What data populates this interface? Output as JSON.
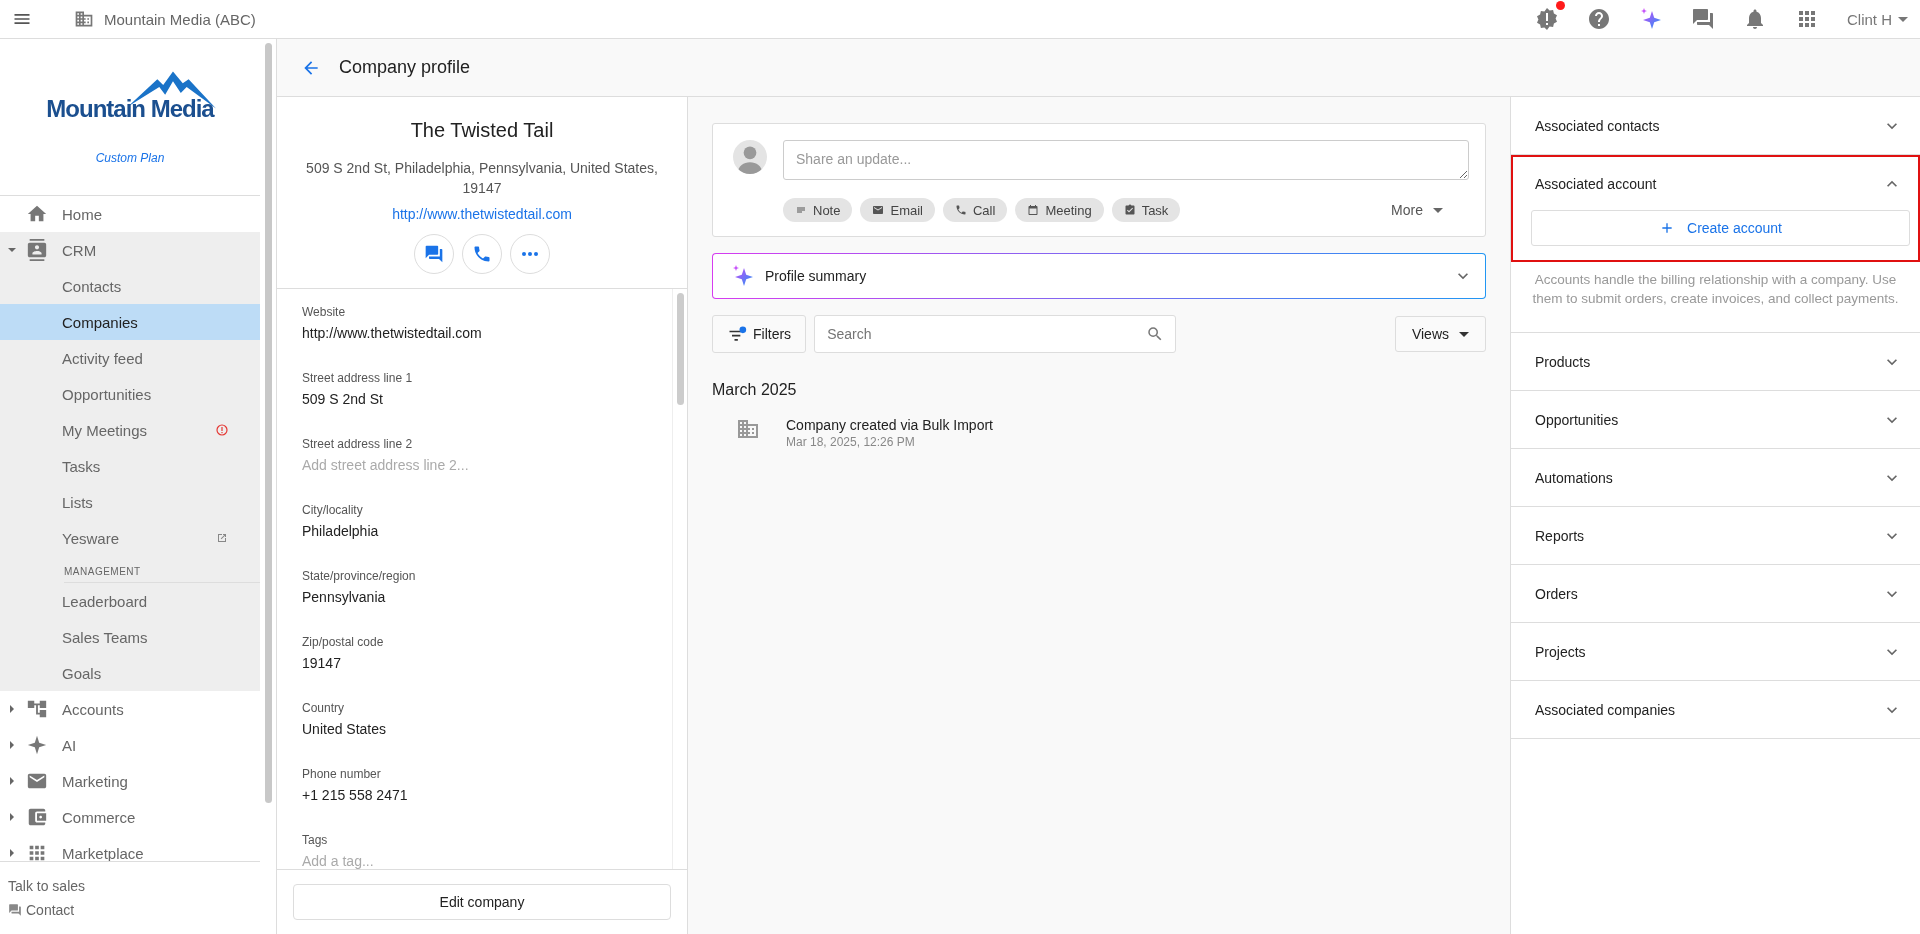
{
  "top_bar": {
    "org": "Mountain Media (ABC)",
    "alert_dot": true,
    "user": "Clint H"
  },
  "sidebar": {
    "logo_text": "Mountain Media",
    "plan": "Custom Plan",
    "items": [
      {
        "label": "Home"
      },
      {
        "label": "CRM",
        "expanded": true,
        "children": [
          {
            "kind": "link",
            "label": "Contacts",
            "selected": false,
            "alert": false,
            "external": false
          },
          {
            "kind": "link",
            "label": "Companies",
            "selected": true,
            "alert": false,
            "external": false
          },
          {
            "kind": "link",
            "label": "Activity feed",
            "selected": false,
            "alert": false,
            "external": false
          },
          {
            "kind": "link",
            "label": "Opportunities",
            "selected": false,
            "alert": false,
            "external": false
          },
          {
            "kind": "link",
            "label": "My Meetings",
            "selected": false,
            "alert": true,
            "external": false
          },
          {
            "kind": "link",
            "label": "Tasks",
            "selected": false,
            "alert": false,
            "external": false
          },
          {
            "kind": "link",
            "label": "Lists",
            "selected": false,
            "alert": false,
            "external": false
          },
          {
            "kind": "link",
            "label": "Yesware",
            "selected": false,
            "alert": false,
            "external": true
          },
          {
            "kind": "heading",
            "label": "MANAGEMENT"
          },
          {
            "kind": "link",
            "label": "Leaderboard",
            "selected": false,
            "alert": false,
            "external": false
          },
          {
            "kind": "link",
            "label": "Sales Teams",
            "selected": false,
            "alert": false,
            "external": false
          },
          {
            "kind": "link",
            "label": "Goals",
            "selected": false,
            "alert": false,
            "external": false
          }
        ]
      },
      {
        "label": "Accounts",
        "expanded": false
      },
      {
        "label": "AI",
        "expanded": false
      },
      {
        "label": "Marketing",
        "expanded": false
      },
      {
        "label": "Commerce",
        "expanded": false
      },
      {
        "label": "Marketplace",
        "expanded": false
      }
    ],
    "footer": {
      "talk": "Talk to sales",
      "contact": "Contact"
    }
  },
  "page_title": "Company profile",
  "company": {
    "name": "The Twisted Tail",
    "address": "509 S 2nd St, Philadelphia, Pennsylvania, United States, 19147",
    "website": "http://www.thetwistedtail.com",
    "fields": [
      {
        "label": "Website",
        "value": "http://www.thetwistedtail.com"
      },
      {
        "label": "Street address line 1",
        "value": "509 S 2nd St"
      },
      {
        "label": "Street address line 2",
        "placeholder": "Add street address line 2..."
      },
      {
        "label": "City/locality",
        "value": "Philadelphia"
      },
      {
        "label": "State/province/region",
        "value": "Pennsylvania"
      },
      {
        "label": "Zip/postal code",
        "value": "19147"
      },
      {
        "label": "Country",
        "value": "United States"
      },
      {
        "label": "Phone number",
        "value": "+1 215 558 2471"
      },
      {
        "label": "Tags",
        "placeholder": "Add a tag..."
      }
    ],
    "edit_button": "Edit company"
  },
  "composer": {
    "placeholder": "Share an update...",
    "chips": [
      "Note",
      "Email",
      "Call",
      "Meeting",
      "Task"
    ],
    "more": "More"
  },
  "profile_summary": {
    "title": "Profile summary",
    "expanded": false
  },
  "activity": {
    "filters": "Filters",
    "filters_active": true,
    "search_placeholder": "Search",
    "views": "Views",
    "month": "March 2025",
    "events": [
      {
        "title": "Company created via Bulk Import",
        "time": "Mar 18, 2025, 12:26 PM"
      }
    ]
  },
  "panels": [
    {
      "title": "Associated contacts",
      "expanded": false,
      "highlighted": false
    },
    {
      "title": "Associated account",
      "expanded": true,
      "highlighted": true,
      "action": "Create account",
      "description": "Accounts handle the billing relationship with a company. Use them to submit orders, create invoices, and collect payments."
    },
    {
      "title": "Products",
      "expanded": false,
      "highlighted": false
    },
    {
      "title": "Opportunities",
      "expanded": false,
      "highlighted": false
    },
    {
      "title": "Automations",
      "expanded": false,
      "highlighted": false
    },
    {
      "title": "Reports",
      "expanded": false,
      "highlighted": false
    },
    {
      "title": "Orders",
      "expanded": false,
      "highlighted": false
    },
    {
      "title": "Projects",
      "expanded": false,
      "highlighted": false
    },
    {
      "title": "Associated companies",
      "expanded": false,
      "highlighted": false
    }
  ]
}
